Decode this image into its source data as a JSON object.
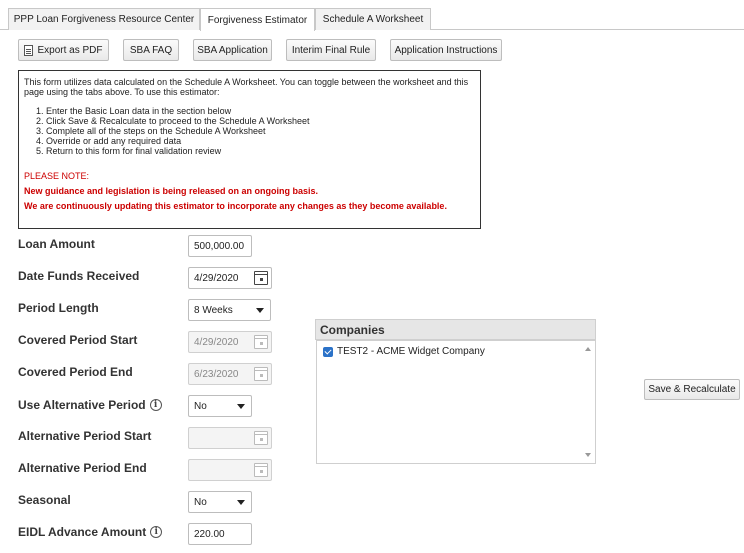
{
  "tabs": [
    {
      "label": "PPP Loan Forgiveness Resource Center"
    },
    {
      "label": "Forgiveness Estimator"
    },
    {
      "label": "Schedule A Worksheet"
    }
  ],
  "toolbar": {
    "export_pdf": "Export as PDF",
    "sba_faq": "SBA FAQ",
    "sba_application": "SBA Application",
    "interim_final_rule": "Interim Final Rule",
    "application_instructions": "Application Instructions"
  },
  "info": {
    "intro": "This form utilizes data calculated on the Schedule A Worksheet. You can toggle between the worksheet and this page using the tabs above. To use this estimator:",
    "steps": [
      "Enter the Basic Loan data in the section below",
      "Click Save & Recalculate to proceed to the Schedule A Worksheet",
      "Complete all of the steps on the Schedule A Worksheet",
      "Override or add any required data",
      "Return to this form for final validation review"
    ],
    "note_head": "PLEASE NOTE:",
    "note_1": "New guidance and legislation is being released on an ongoing basis.",
    "note_2": "We are continuously updating this estimator to incorporate any changes as they become available."
  },
  "form": {
    "loan_amount": {
      "label": "Loan Amount",
      "value": "500,000.00"
    },
    "date_funds_received": {
      "label": "Date Funds Received",
      "value": "4/29/2020"
    },
    "period_length": {
      "label": "Period Length",
      "value": "8 Weeks"
    },
    "covered_period_start": {
      "label": "Covered Period Start",
      "value": "4/29/2020"
    },
    "covered_period_end": {
      "label": "Covered Period End",
      "value": "6/23/2020"
    },
    "use_alternative_period": {
      "label": "Use Alternative Period",
      "value": "No"
    },
    "alternative_period_start": {
      "label": "Alternative Period Start",
      "value": ""
    },
    "alternative_period_end": {
      "label": "Alternative Period End",
      "value": ""
    },
    "seasonal": {
      "label": "Seasonal",
      "value": "No"
    },
    "eidl_advance_amount": {
      "label": "EIDL Advance Amount",
      "value": "220.00"
    }
  },
  "companies": {
    "title": "Companies",
    "items": [
      {
        "label": "TEST2 - ACME Widget Company",
        "checked": true
      }
    ]
  },
  "save_button": "Save & Recalculate",
  "info_glyph": "i"
}
